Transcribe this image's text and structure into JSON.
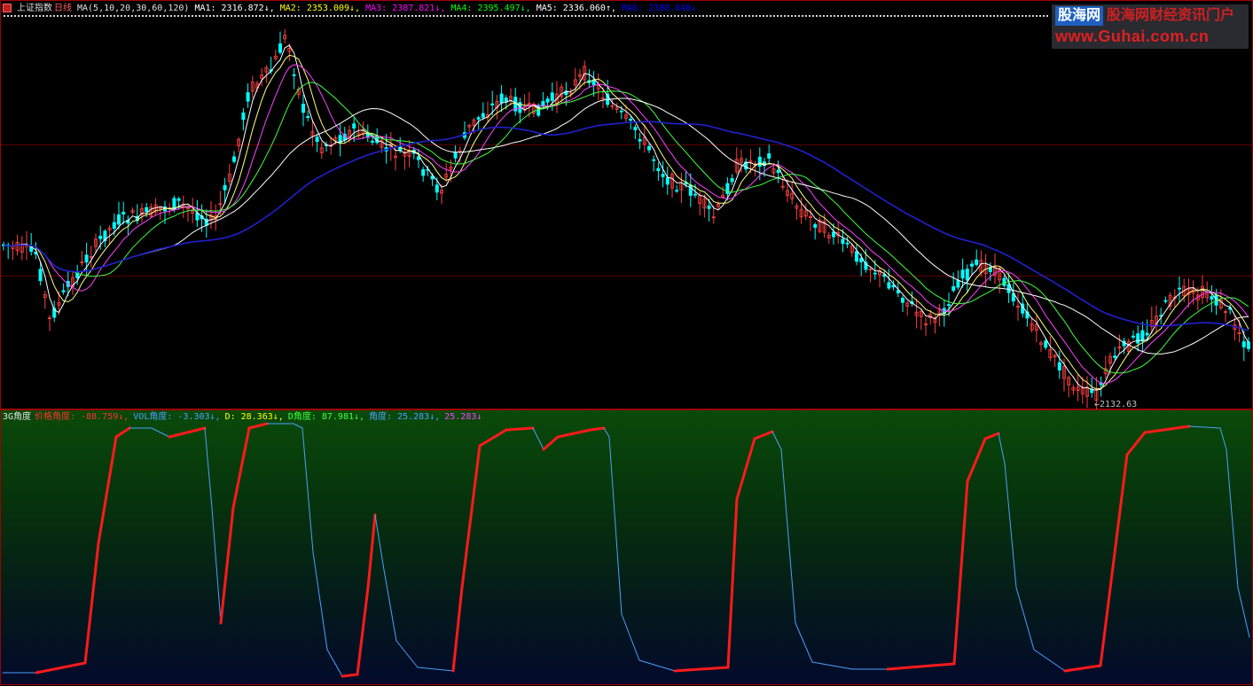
{
  "main_chart": {
    "index_name": "上证指数",
    "period": "日线",
    "ma_params": "MA(5,10,20,30,60,120)",
    "ma_readouts": [
      {
        "label": "MA1:",
        "value": "2316.872",
        "arrow": "↓",
        "color": "#ffffff"
      },
      {
        "label": "MA2:",
        "value": "2353.009",
        "arrow": "↓",
        "color": "#ffff00"
      },
      {
        "label": "MA3:",
        "value": "2387.821",
        "arrow": "↓",
        "color": "#ff00ff"
      },
      {
        "label": "MA4:",
        "value": "2395.497",
        "arrow": "↓",
        "color": "#00ff00"
      },
      {
        "label": "MA5:",
        "value": "2336.060",
        "arrow": "↑",
        "color": "#ffffff"
      },
      {
        "label": "MA6:",
        "value": "2388.648",
        "arrow": "↓",
        "color": "#0000ff"
      }
    ],
    "low_label": "←2132.63",
    "colors": {
      "up": "#ff4040",
      "down": "#00ffff",
      "ma5": "#ffffff",
      "ma10": "#ffff80",
      "ma20": "#ff40ff",
      "ma30": "#40ff40",
      "ma60": "#ffffff",
      "ma120": "#2020d0"
    }
  },
  "sub_chart": {
    "name": "3G角度",
    "fields": [
      {
        "label": "价格角度:",
        "value": "-88.759",
        "arrow": "↓",
        "color": "#ff3030"
      },
      {
        "label": "VOL角度:",
        "value": "-3.303",
        "arrow": "↓",
        "color": "#4aa0ff"
      },
      {
        "label": "D:",
        "value": "28.363",
        "arrow": "↓",
        "color": "#ffff00"
      },
      {
        "label": "D角度:",
        "value": "87.981",
        "arrow": "↓",
        "color": "#40ff40"
      },
      {
        "label": "角度:",
        "value": "25.283",
        "arrow": "↓",
        "color": "#4aa0ff"
      },
      {
        "label": "",
        "value": "25.283",
        "arrow": "↓",
        "color": "#ff40ff"
      }
    ],
    "line_colors": {
      "rising": "#ff1a1a",
      "falling": "#4aa0ff"
    }
  },
  "watermark": {
    "logo": "股海网",
    "slogan": "股海网财经资讯门户",
    "url": "www.Guhai.com.cn"
  }
}
